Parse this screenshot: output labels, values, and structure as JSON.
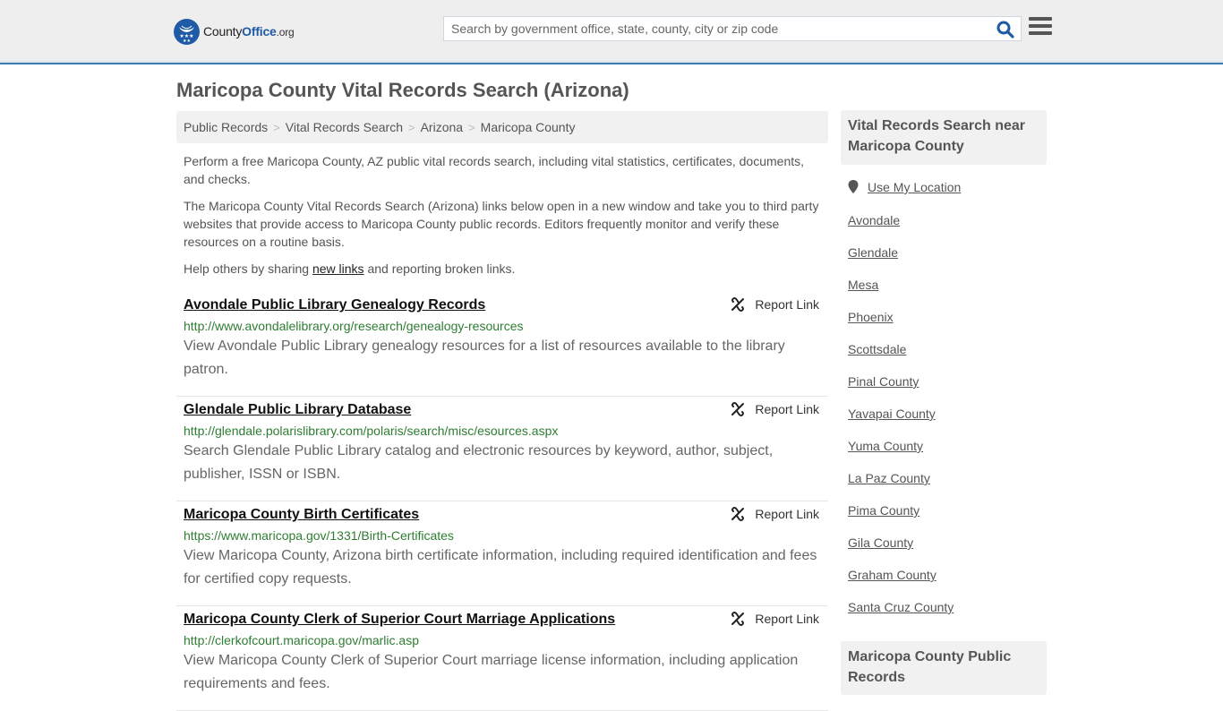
{
  "header": {
    "logo": {
      "name_main": "County",
      "name_accent": "Office",
      "name_suffix": ".org"
    },
    "search": {
      "placeholder": "Search by government office, state, county, city or zip code",
      "value": ""
    },
    "icons": {
      "search": "search-icon",
      "menu": "hamburger-menu-icon"
    }
  },
  "page": {
    "title": "Maricopa County Vital Records Search (Arizona)",
    "breadcrumb": [
      "Public Records",
      "Vital Records Search",
      "Arizona",
      "Maricopa County"
    ],
    "intro": {
      "p1": "Perform a free Maricopa County, AZ public vital records search, including vital statistics, certificates, documents, and checks.",
      "p2": "The Maricopa County Vital Records Search (Arizona) links below open in a new window and take you to third party websites that provide access to Maricopa County public records. Editors frequently monitor and verify these resources on a routine basis.",
      "p3_before": "Help others by sharing ",
      "p3_link": "new links",
      "p3_after": " and reporting broken links."
    },
    "report_label": "Report Link",
    "results": [
      {
        "title": "Avondale Public Library Genealogy Records",
        "url": "http://www.avondalelibrary.org/research/genealogy-resources",
        "description": "View Avondale Public Library genealogy resources for a list of resources available to the library patron."
      },
      {
        "title": "Glendale Public Library Database",
        "url": "http://glendale.polarislibrary.com/polaris/search/misc/esources.aspx",
        "description": "Search Glendale Public Library catalog and electronic resources by keyword, author, subject, publisher, ISSN or ISBN."
      },
      {
        "title": "Maricopa County Birth Certificates",
        "url": "https://www.maricopa.gov/1331/Birth-Certificates",
        "description": "View Maricopa County, Arizona birth certificate information, including required identification and fees for certified copy requests."
      },
      {
        "title": "Maricopa County Clerk of Superior Court Marriage Applications",
        "url": "http://clerkofcourt.maricopa.gov/marlic.asp",
        "description": "View Maricopa County Clerk of Superior Court marriage license information, including application requirements and fees."
      }
    ]
  },
  "sidebar": {
    "nearby_heading": "Vital Records Search near Maricopa County",
    "use_location": "Use My Location",
    "nearby_links": [
      "Avondale",
      "Glendale",
      "Mesa",
      "Phoenix",
      "Scottsdale",
      "Pinal County",
      "Yavapai County",
      "Yuma County",
      "La Paz County",
      "Pima County",
      "Gila County",
      "Graham County",
      "Santa Cruz County"
    ],
    "public_records_heading": "Maricopa County Public Records"
  },
  "colors": {
    "brand_blue": "#1f5aa6",
    "header_border": "#3a7bb0",
    "url_green": "#2e7d32",
    "text_gray": "#555555"
  }
}
